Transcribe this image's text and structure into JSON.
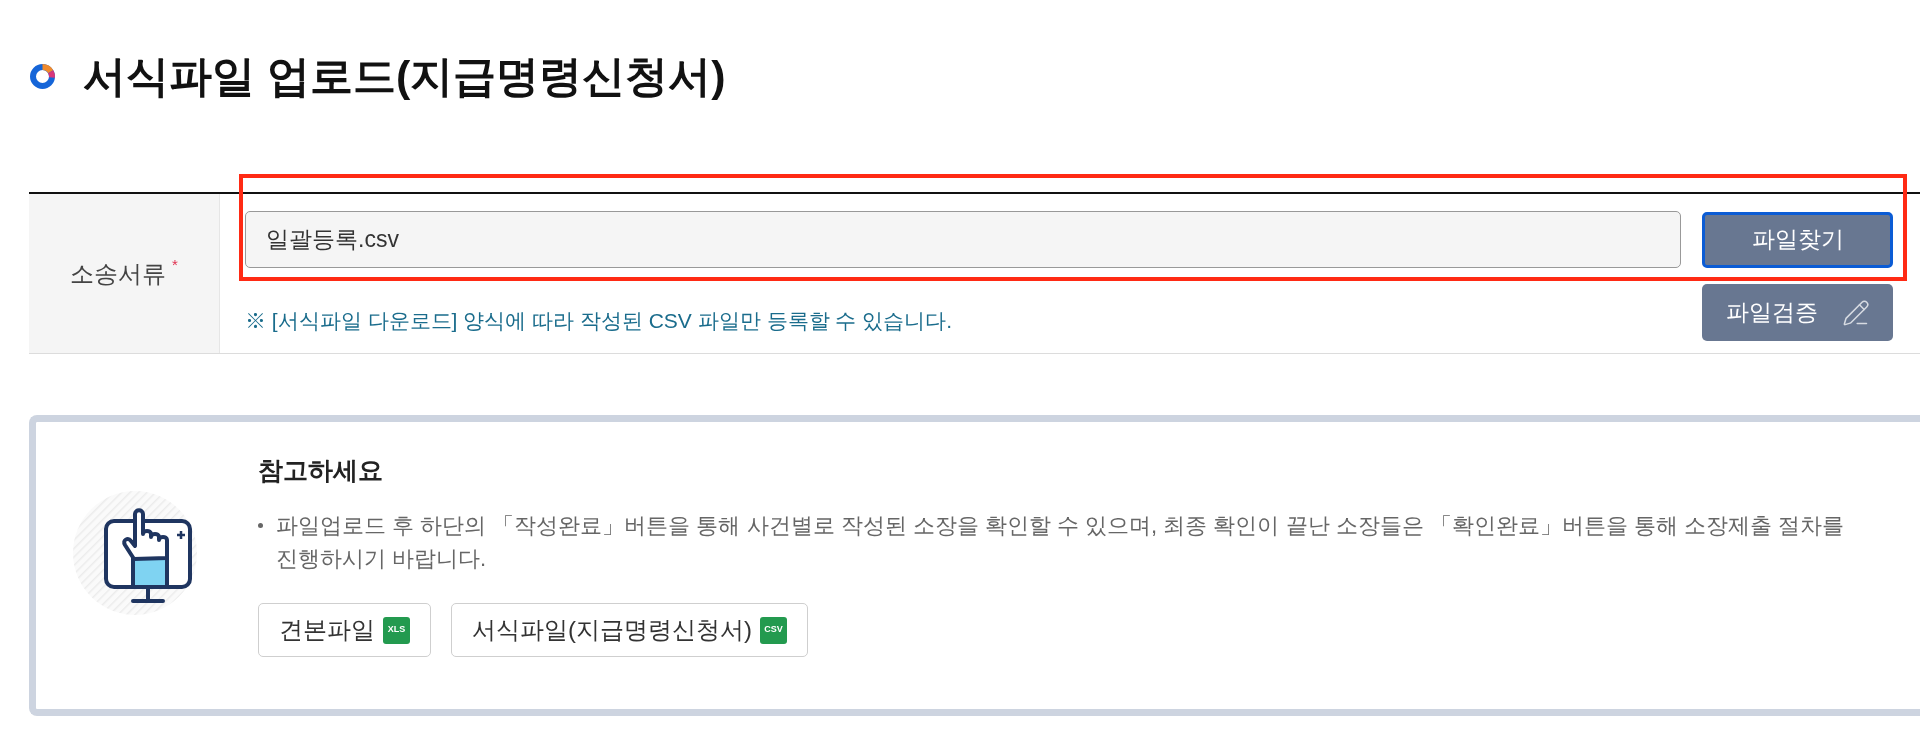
{
  "page": {
    "title": "서식파일 업로드(지급명령신청서)"
  },
  "form": {
    "rows": [
      {
        "label": "소송서류",
        "required_mark": "*",
        "highlighted": true,
        "file_field": {
          "value": "일괄등록.csv"
        },
        "browse_button": {
          "label": "파일찾기",
          "focused": true
        },
        "help_text": "※ [서식파일 다운로드] 양식에 따라 작성된 CSV 파일만 등록할 수 있습니다.",
        "verify_button": {
          "label": "파일검증"
        }
      }
    ]
  },
  "notice": {
    "heading": "참고하세요",
    "bullets": [
      "파일업로드 후 하단의 「작성완료」버튼을 통해 사건별로 작성된 소장을 확인할 수 있으며, 최종 확인이 끝난 소장들은 「확인완료」버튼을 통해 소장제출 절차를 진행하시기 바랍니다."
    ],
    "downloads": [
      {
        "label": "견본파일",
        "file_type": "XLS"
      },
      {
        "label": "서식파일(지급명령신청서)",
        "file_type": "CSV"
      }
    ]
  }
}
